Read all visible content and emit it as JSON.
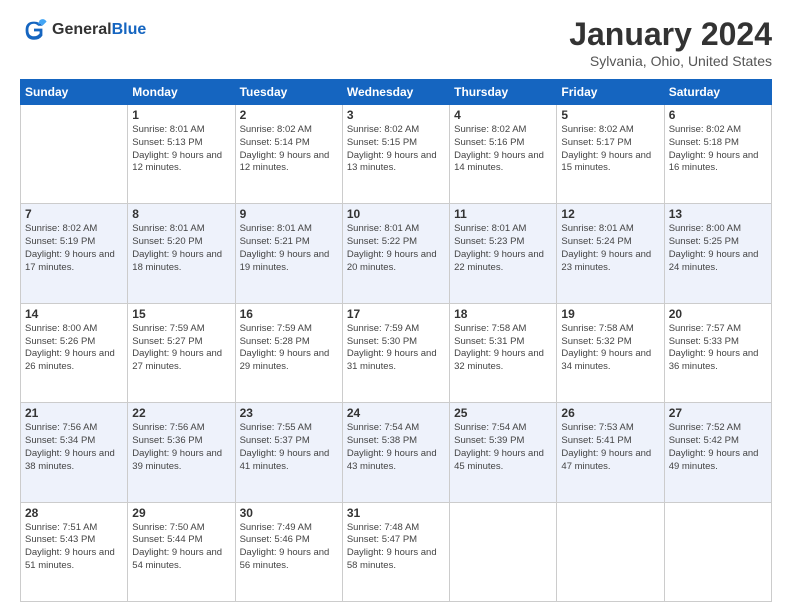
{
  "header": {
    "logo_general": "General",
    "logo_blue": "Blue",
    "month_title": "January 2024",
    "location": "Sylvania, Ohio, United States"
  },
  "calendar": {
    "days_of_week": [
      "Sunday",
      "Monday",
      "Tuesday",
      "Wednesday",
      "Thursday",
      "Friday",
      "Saturday"
    ],
    "weeks": [
      [
        {
          "day": "",
          "info": ""
        },
        {
          "day": "1",
          "info": "Sunrise: 8:01 AM\nSunset: 5:13 PM\nDaylight: 9 hours\nand 12 minutes."
        },
        {
          "day": "2",
          "info": "Sunrise: 8:02 AM\nSunset: 5:14 PM\nDaylight: 9 hours\nand 12 minutes."
        },
        {
          "day": "3",
          "info": "Sunrise: 8:02 AM\nSunset: 5:15 PM\nDaylight: 9 hours\nand 13 minutes."
        },
        {
          "day": "4",
          "info": "Sunrise: 8:02 AM\nSunset: 5:16 PM\nDaylight: 9 hours\nand 14 minutes."
        },
        {
          "day": "5",
          "info": "Sunrise: 8:02 AM\nSunset: 5:17 PM\nDaylight: 9 hours\nand 15 minutes."
        },
        {
          "day": "6",
          "info": "Sunrise: 8:02 AM\nSunset: 5:18 PM\nDaylight: 9 hours\nand 16 minutes."
        }
      ],
      [
        {
          "day": "7",
          "info": "Sunrise: 8:02 AM\nSunset: 5:19 PM\nDaylight: 9 hours\nand 17 minutes."
        },
        {
          "day": "8",
          "info": "Sunrise: 8:01 AM\nSunset: 5:20 PM\nDaylight: 9 hours\nand 18 minutes."
        },
        {
          "day": "9",
          "info": "Sunrise: 8:01 AM\nSunset: 5:21 PM\nDaylight: 9 hours\nand 19 minutes."
        },
        {
          "day": "10",
          "info": "Sunrise: 8:01 AM\nSunset: 5:22 PM\nDaylight: 9 hours\nand 20 minutes."
        },
        {
          "day": "11",
          "info": "Sunrise: 8:01 AM\nSunset: 5:23 PM\nDaylight: 9 hours\nand 22 minutes."
        },
        {
          "day": "12",
          "info": "Sunrise: 8:01 AM\nSunset: 5:24 PM\nDaylight: 9 hours\nand 23 minutes."
        },
        {
          "day": "13",
          "info": "Sunrise: 8:00 AM\nSunset: 5:25 PM\nDaylight: 9 hours\nand 24 minutes."
        }
      ],
      [
        {
          "day": "14",
          "info": "Sunrise: 8:00 AM\nSunset: 5:26 PM\nDaylight: 9 hours\nand 26 minutes."
        },
        {
          "day": "15",
          "info": "Sunrise: 7:59 AM\nSunset: 5:27 PM\nDaylight: 9 hours\nand 27 minutes."
        },
        {
          "day": "16",
          "info": "Sunrise: 7:59 AM\nSunset: 5:28 PM\nDaylight: 9 hours\nand 29 minutes."
        },
        {
          "day": "17",
          "info": "Sunrise: 7:59 AM\nSunset: 5:30 PM\nDaylight: 9 hours\nand 31 minutes."
        },
        {
          "day": "18",
          "info": "Sunrise: 7:58 AM\nSunset: 5:31 PM\nDaylight: 9 hours\nand 32 minutes."
        },
        {
          "day": "19",
          "info": "Sunrise: 7:58 AM\nSunset: 5:32 PM\nDaylight: 9 hours\nand 34 minutes."
        },
        {
          "day": "20",
          "info": "Sunrise: 7:57 AM\nSunset: 5:33 PM\nDaylight: 9 hours\nand 36 minutes."
        }
      ],
      [
        {
          "day": "21",
          "info": "Sunrise: 7:56 AM\nSunset: 5:34 PM\nDaylight: 9 hours\nand 38 minutes."
        },
        {
          "day": "22",
          "info": "Sunrise: 7:56 AM\nSunset: 5:36 PM\nDaylight: 9 hours\nand 39 minutes."
        },
        {
          "day": "23",
          "info": "Sunrise: 7:55 AM\nSunset: 5:37 PM\nDaylight: 9 hours\nand 41 minutes."
        },
        {
          "day": "24",
          "info": "Sunrise: 7:54 AM\nSunset: 5:38 PM\nDaylight: 9 hours\nand 43 minutes."
        },
        {
          "day": "25",
          "info": "Sunrise: 7:54 AM\nSunset: 5:39 PM\nDaylight: 9 hours\nand 45 minutes."
        },
        {
          "day": "26",
          "info": "Sunrise: 7:53 AM\nSunset: 5:41 PM\nDaylight: 9 hours\nand 47 minutes."
        },
        {
          "day": "27",
          "info": "Sunrise: 7:52 AM\nSunset: 5:42 PM\nDaylight: 9 hours\nand 49 minutes."
        }
      ],
      [
        {
          "day": "28",
          "info": "Sunrise: 7:51 AM\nSunset: 5:43 PM\nDaylight: 9 hours\nand 51 minutes."
        },
        {
          "day": "29",
          "info": "Sunrise: 7:50 AM\nSunset: 5:44 PM\nDaylight: 9 hours\nand 54 minutes."
        },
        {
          "day": "30",
          "info": "Sunrise: 7:49 AM\nSunset: 5:46 PM\nDaylight: 9 hours\nand 56 minutes."
        },
        {
          "day": "31",
          "info": "Sunrise: 7:48 AM\nSunset: 5:47 PM\nDaylight: 9 hours\nand 58 minutes."
        },
        {
          "day": "",
          "info": ""
        },
        {
          "day": "",
          "info": ""
        },
        {
          "day": "",
          "info": ""
        }
      ]
    ]
  }
}
